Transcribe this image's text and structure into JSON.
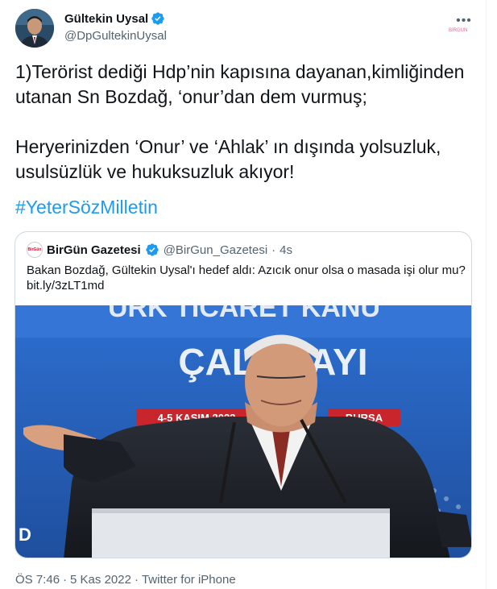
{
  "author": {
    "name": "Gültekin Uysal",
    "handle": "@DpGultekinUysal",
    "verified": true,
    "avatar_icon": "profile-photo"
  },
  "menu": {
    "icon": "more-icon",
    "label": "•••"
  },
  "stamp": "BİRGÜN",
  "tweet": {
    "text": "1)Terörist dediği Hdp’nin kapısına dayanan,kimliğinden utanan Sn Bozdağ, ‘onur’dan dem vurmuş;\n\nHeryerinizden ‘Onur’ ve ‘Ahlak’ ın dışında yolsuzluk, usulsüzlük ve hukuksuzluk akıyor!",
    "hashtag": "#YeterSözMilletin"
  },
  "quote": {
    "name": "BirGün Gazetesi",
    "handle": "@BirGun_Gazetesi",
    "separator": "·",
    "time": "4s",
    "avatar_text": "BirGün",
    "text": "Bakan Bozdağ, Gültekin Uysal'ı hedef aldı: Azıcık onur olsa o masada işi olur mu?",
    "link": "bit.ly/3zLT1md",
    "photo": {
      "banner_top": "ÜRK TİCARET KANU",
      "banner_main": "ÇALIŞTAYI",
      "date_text": "4-5 KASIM 2022",
      "city_text": "BURSA",
      "side_text": "D",
      "colors": {
        "banner": "#2b67c6",
        "red": "#c8262c"
      }
    }
  },
  "meta": {
    "time": "ÖS 7:46",
    "sep1": "·",
    "date": "5 Kas 2022",
    "sep2": "·",
    "source": "Twitter for iPhone"
  },
  "colors": {
    "accent": "#1d9bf0",
    "text": "#0f1419",
    "muted": "#536471"
  }
}
